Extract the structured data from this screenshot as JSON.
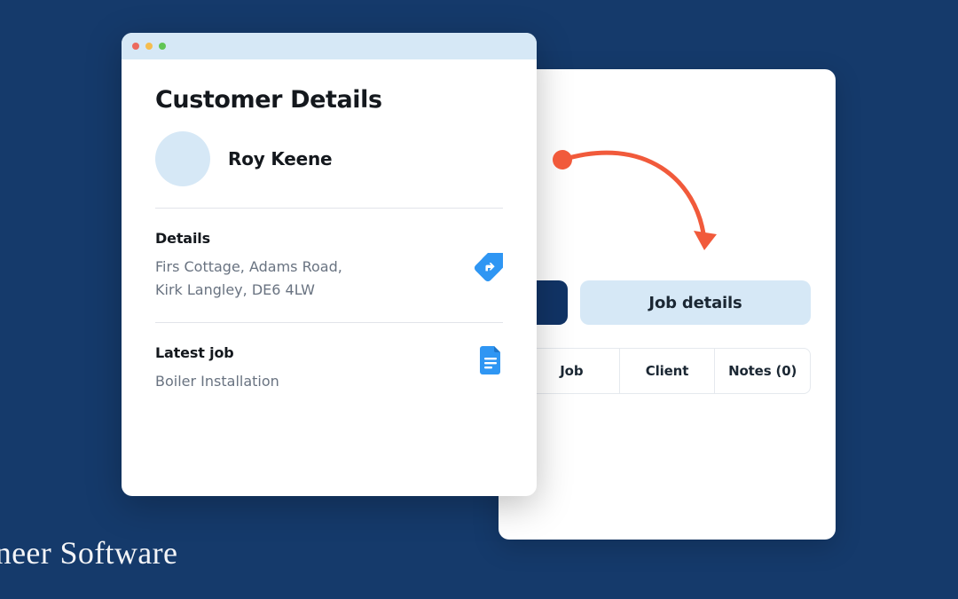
{
  "customerPanel": {
    "title": "Customer Details",
    "customerName": "Roy Keene",
    "detailsSection": {
      "heading": "Details",
      "addressLine1": "Firs Cottage, Adams Road,",
      "addressLine2": "Kirk Langley, DE6 4LW"
    },
    "latestJobSection": {
      "heading": "Latest job",
      "jobName": "Boiler Installation"
    }
  },
  "jobPanel": {
    "primaryTab": "Job details",
    "tabs": {
      "job": "Job",
      "client": "Client",
      "notes": "Notes (0)"
    }
  },
  "watermark": "gineer Software",
  "colors": {
    "accent": "#2f96f3",
    "arrow": "#f15a3b",
    "navy": "#153a6b",
    "lightBlue": "#d6e8f6"
  }
}
